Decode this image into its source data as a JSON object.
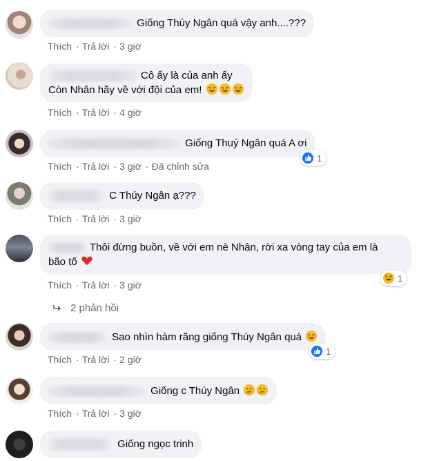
{
  "comments": [
    {
      "text": "Giống Thúy Ngân quá vậy anh....???",
      "like": "Thích",
      "reply": "Trả lời",
      "time": "3 giờ"
    },
    {
      "line1": "Cô ấy là của anh ấy",
      "line2": "Còn Nhân hãy về với đội của em!",
      "like": "Thích",
      "reply": "Trả lời",
      "time": "4 giờ"
    },
    {
      "text": "Giống Thuý Ngân quá A ơi",
      "like": "Thích",
      "reply": "Trả lời",
      "time": "3 giờ",
      "edited": "Đã chỉnh sửa",
      "reaction_count": "1"
    },
    {
      "text": "C Thúy Ngân ạ???",
      "like": "Thích",
      "reply": "Trả lời",
      "time": "3 giờ"
    },
    {
      "line1": "Thôi đừng buồn, về với em nè Nhân, rời xa vòng tay của em là",
      "line2": "bão tố",
      "like": "Thích",
      "reply": "Trả lời",
      "time": "3 giờ",
      "reaction_count": "1"
    },
    {
      "text": "Sao nhìn hàm răng giống Thúy Ngân quá",
      "like": "Thích",
      "reply": "Trả lời",
      "time": "2 giờ",
      "reaction_count": "1"
    },
    {
      "text": "Giống c Thúy Ngân",
      "like": "Thích",
      "reply": "Trả lời",
      "time": "3 giờ"
    },
    {
      "text": "Giống ngọc trinh"
    }
  ],
  "replies_link": "2 phản hồi",
  "colors": {
    "bubble": "#f0f2f5",
    "meta": "#65676b",
    "like_blue": "#1877f2"
  }
}
